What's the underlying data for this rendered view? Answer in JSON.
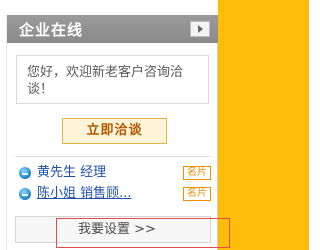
{
  "widget": {
    "title": "企业在线",
    "greeting": "您好，欢迎新老客户咨询洽谈！",
    "chat_button": "立即洽谈",
    "contacts": [
      {
        "name": "黄先生 经理",
        "card_label": "名片"
      },
      {
        "name": "陈小姐 销售顾...",
        "card_label": "名片"
      }
    ],
    "settings_button": "我要设置 >>"
  },
  "icons": {
    "collapse": "arrow-right-icon",
    "contact": "qq-icon"
  },
  "colors": {
    "background_orange": "#ffbd09",
    "header_gray": "#8f8f8f",
    "chat_button_bg": "#fff4d7",
    "chat_button_text": "#b45800",
    "contact_link": "#1f52a6",
    "card_badge": "#f08e00",
    "focus_outline": "#e24c4c"
  }
}
